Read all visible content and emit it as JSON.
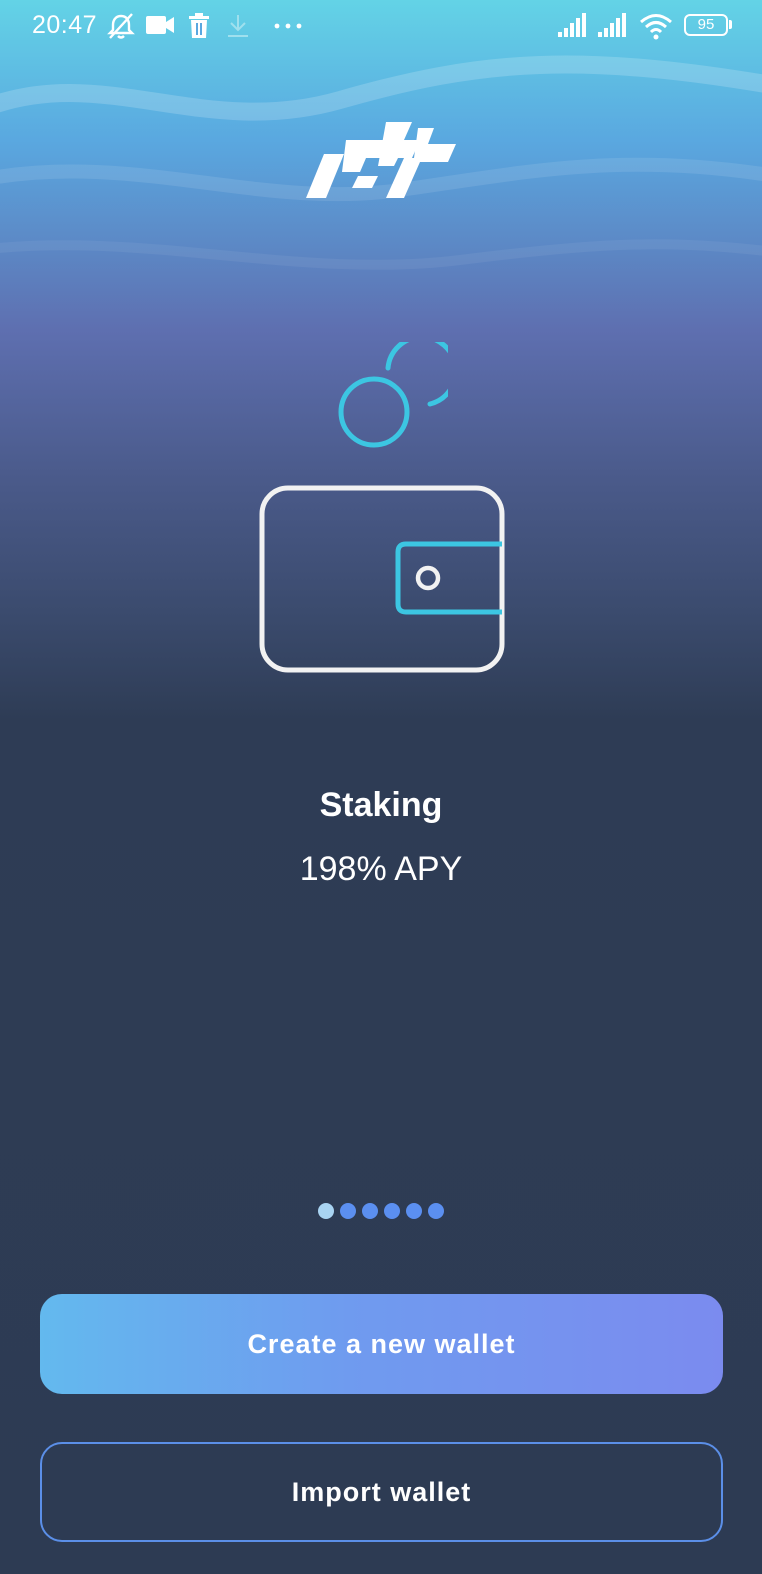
{
  "status_bar": {
    "time": "20:47",
    "battery": "95",
    "icons": [
      "alarm-off-icon",
      "video-camera-icon",
      "trash-icon",
      "download-icon",
      "more-dots-icon",
      "signal-icon",
      "signal-icon",
      "wifi-icon",
      "battery-icon"
    ]
  },
  "brand": {
    "logo": "app-logo"
  },
  "slide": {
    "title": "Staking",
    "subtitle": "198% APY",
    "illustration": [
      "coin-icon",
      "wallet-icon"
    ]
  },
  "pagination": {
    "count": 6,
    "active_index": 0
  },
  "actions": {
    "create_label": "Create a new wallet",
    "import_label": "Import wallet"
  },
  "colors": {
    "accent_cyan": "#3cc6e2",
    "button_gradient_start": "#63b9ee",
    "button_gradient_end": "#7b8bef",
    "background_dark": "#2d3b53",
    "dot_active": "#a9d4f2",
    "dot_inactive": "#5b8ff0"
  }
}
